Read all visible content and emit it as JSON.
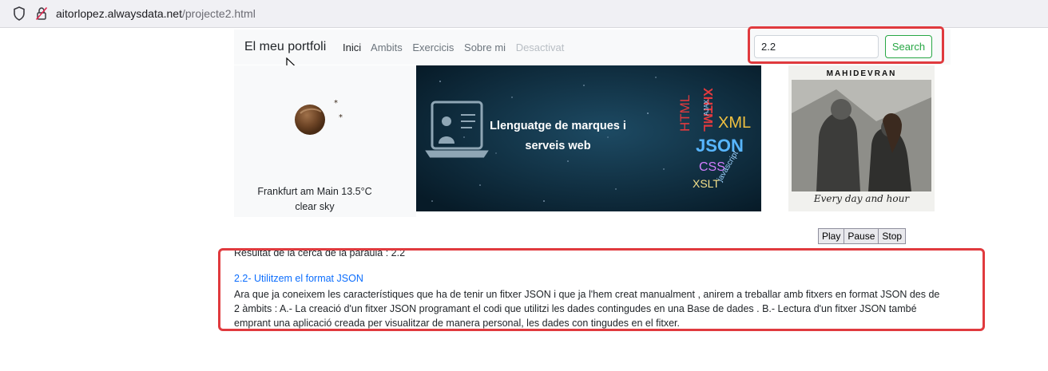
{
  "browser": {
    "url_domain": "aitorlopez.alwaysdata.net",
    "url_path": "/projecte2.html"
  },
  "navbar": {
    "brand": "El meu portfoli",
    "links": [
      {
        "label": "Inici",
        "state": "active"
      },
      {
        "label": "Ambits",
        "state": "normal"
      },
      {
        "label": "Exercicis",
        "state": "normal"
      },
      {
        "label": "Sobre mi",
        "state": "normal"
      },
      {
        "label": "Desactivat",
        "state": "disabled"
      }
    ],
    "search_value": "2.2",
    "search_button": "Search"
  },
  "weather": {
    "location_temp": "Frankfurt am Main 13.5°C",
    "description": "clear sky"
  },
  "banner": {
    "line1": "Llenguatge de marques i",
    "line2": "serveis web",
    "words": [
      "XHTML",
      "XML",
      "JSON",
      "HTML",
      "CSS",
      "XSLT",
      "AJAX",
      "javascript"
    ]
  },
  "album": {
    "artist": "MAHIDEVRAN",
    "tagline": "Every day and hour"
  },
  "player": {
    "play": "Play",
    "pause": "Pause",
    "stop": "Stop"
  },
  "results": {
    "heading": "Resultat de la cerca de la paraula : 2.2",
    "title": "2.2- Utilitzem el format JSON",
    "body": "Ara que ja coneixem les característiques que ha de tenir un fitxer JSON i que ja l'hem creat manualment , anirem a treballar amb fitxers en format JSON des de 2 àmbits : A.- La creació d'un fitxer JSON programant el codi que utilitzi les dades contingudes en una Base de dades . B.- Lectura d'un fitxer JSON també emprant una aplicació creada per visualitzar de manera personal, les dades con tingudes en el fitxer."
  },
  "colors": {
    "highlight": "#e03a3e",
    "link": "#0d6efd",
    "search_button": "#28a745"
  }
}
